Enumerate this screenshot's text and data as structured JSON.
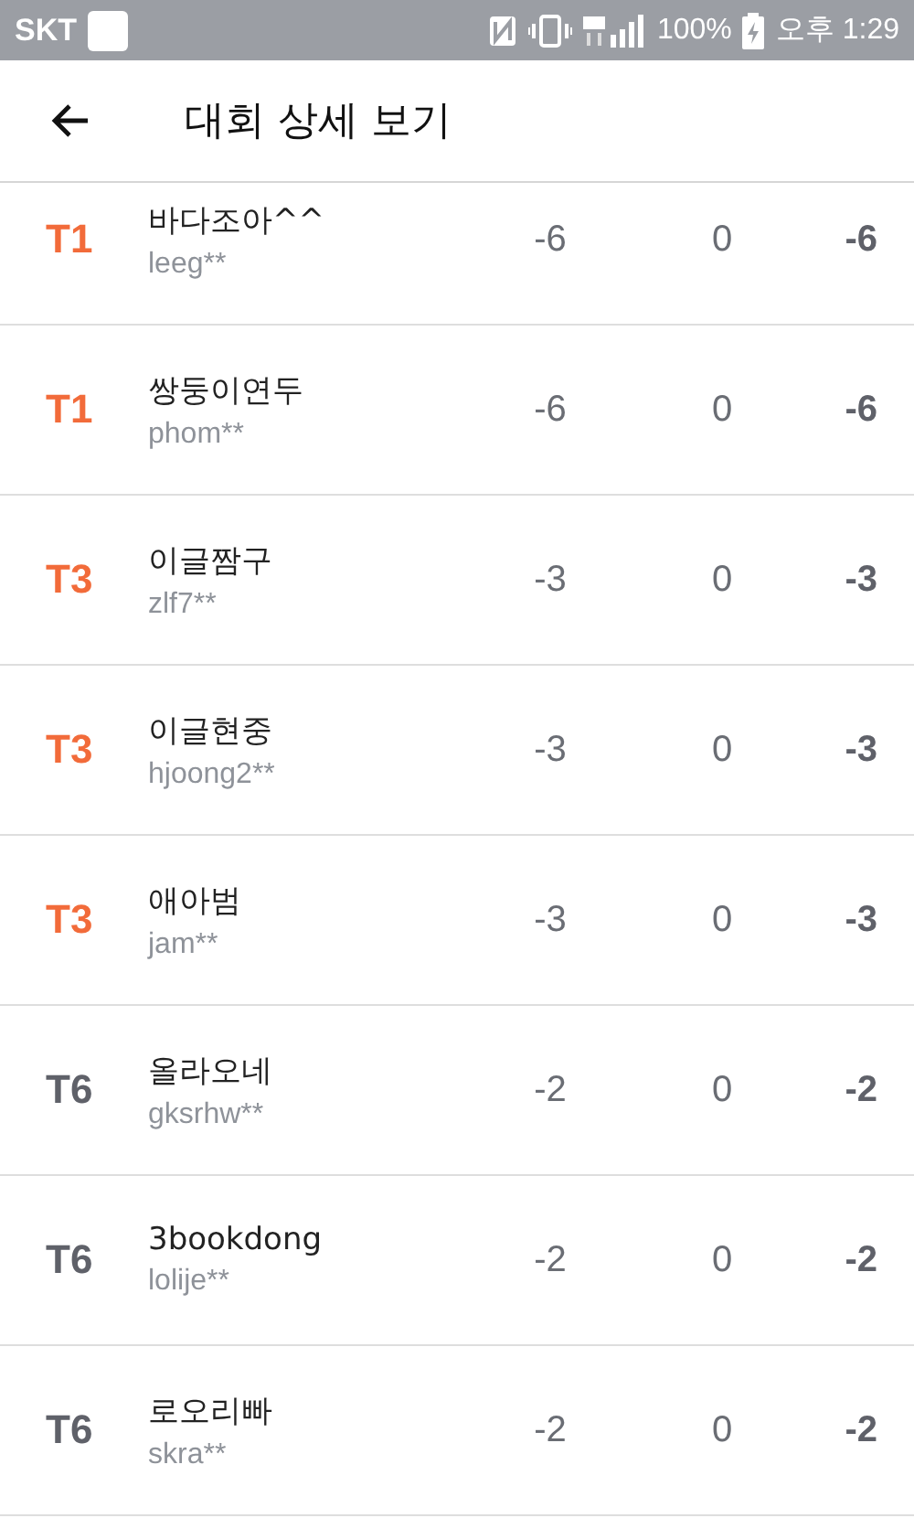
{
  "status_bar": {
    "carrier": "SKT",
    "battery": "100%",
    "time": "오후 1:29"
  },
  "header": {
    "title": "대회 상세 보기"
  },
  "rows": [
    {
      "rank": "T1",
      "color": "#f26b3a",
      "name": "바다조아^^",
      "id": "leeg**",
      "column_3": "-6",
      "column_4": "0",
      "total": "-6"
    },
    {
      "rank": "T1",
      "color": "#f26b3a",
      "name": "쌍둥이연두",
      "id": "phom**",
      "column_3": "-6",
      "column_4": "0",
      "total": "-6"
    },
    {
      "rank": "T3",
      "color": "#f26b3a",
      "name": "이글짬구",
      "id": "zlf7**",
      "column_3": "-3",
      "column_4": "0",
      "total": "-3"
    },
    {
      "rank": "T3",
      "color": "#f26b3a",
      "name": "이글현중",
      "id": "hjoong2**",
      "column_3": "-3",
      "column_4": "0",
      "total": "-3"
    },
    {
      "rank": "T3",
      "color": "#f26b3a",
      "name": "애아범",
      "id": "jam**",
      "column_3": "-3",
      "column_4": "0",
      "total": "-3"
    },
    {
      "rank": "T6",
      "color": "#5f6169",
      "name": "올라오네",
      "id": "gksrhw**",
      "column_3": "-2",
      "column_4": "0",
      "total": "-2"
    },
    {
      "rank": "T6",
      "color": "#5f6169",
      "name": "3bookdong",
      "id": "lolije**",
      "column_3": "-2",
      "column_4": "0",
      "total": "-2"
    },
    {
      "rank": "T6",
      "color": "#5f6169",
      "name": "로오리빠",
      "id": "skra**",
      "column_3": "-2",
      "column_4": "0",
      "total": "-2"
    }
  ]
}
